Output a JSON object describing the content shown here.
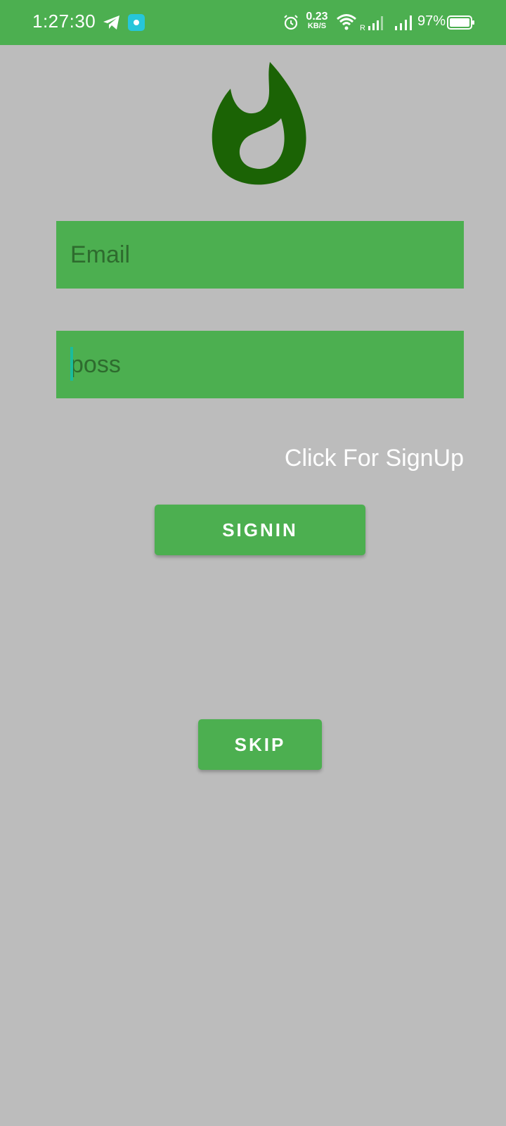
{
  "status_bar": {
    "time": "1:27:30",
    "net_speed_value": "0.23",
    "net_speed_unit": "KB/S",
    "signal_roaming_label": "R",
    "battery_percent": "97%",
    "icons": [
      "telegram-icon",
      "app-notification-icon",
      "alarm-icon",
      "wifi-icon",
      "signal-icon",
      "battery-icon"
    ]
  },
  "logo": {
    "icon": "flame-logo-icon",
    "color": "#1b6305"
  },
  "form": {
    "email_placeholder": "Email",
    "email_value": "",
    "password_placeholder": "",
    "password_value": "poss"
  },
  "signup_link_label": "Click For SignUp",
  "signin_button_label": "SIGNIN",
  "skip_button_label": "SKIP",
  "colors": {
    "primary": "#4caf50",
    "background": "#bcbcbc",
    "input_text": "#2e6b2e",
    "cursor": "#1abc9c"
  }
}
